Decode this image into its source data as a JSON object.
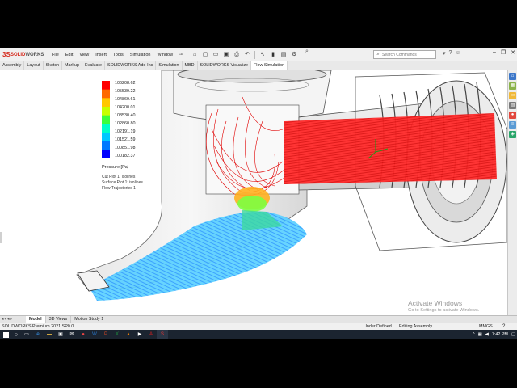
{
  "app": {
    "brand_prefix": "3S",
    "brand_name": "SOLID",
    "brand_suffix": "WORKS"
  },
  "menu": [
    "File",
    "Edit",
    "View",
    "Insert",
    "Tools",
    "Simulation",
    "Window"
  ],
  "quick_access_icons": [
    "home-icon",
    "new-icon",
    "open-icon",
    "save-icon",
    "print-icon",
    "undo-icon",
    "select-icon",
    "rebuild-icon",
    "file-properties-icon",
    "options-icon"
  ],
  "search": {
    "placeholder": "Search Commands"
  },
  "command_tabs": [
    "Assembly",
    "Layout",
    "Sketch",
    "Markup",
    "Evaluate",
    "SOLIDWORKS Add-Ins",
    "Simulation",
    "MBD",
    "SOLIDWORKS Visualize",
    "Flow Simulation"
  ],
  "active_command_tab": "Flow Simulation",
  "legend": {
    "values": [
      "106208.62",
      "105539.22",
      "104869.61",
      "104200.01",
      "103530.40",
      "102860.80",
      "102191.19",
      "101521.59",
      "100851.98",
      "100182.37"
    ],
    "title": "Pressure [Pa]",
    "notes": [
      "Cut Plot 1: isolines",
      "Surface Plot 1: isolines",
      "Flow Trajectories 1"
    ],
    "colors": [
      "#ff0000",
      "#ff6a00",
      "#ffc800",
      "#c8ff00",
      "#3cff3c",
      "#00ffc8",
      "#00c8ff",
      "#0078ff",
      "#0000ff"
    ]
  },
  "watermark": {
    "title": "Activate Windows",
    "subtitle": "Go to Settings to activate Windows."
  },
  "bottom_tabs": [
    "Model",
    "3D Views",
    "Motion Study 1"
  ],
  "active_bottom_tab": "Model",
  "status": {
    "product": "SOLIDWORKS Premium 2021 SP0.0",
    "defined": "Under Defined",
    "editing": "Editing Assembly",
    "units": "MMGS",
    "help": "?"
  },
  "taskbar": {
    "time": "7:42 PM",
    "apps": [
      "task-view-icon",
      "edge-icon",
      "file-explorer-icon",
      "store-icon",
      "mail-icon",
      "chrome-icon",
      "word-icon",
      "powerpoint-icon",
      "excel-icon",
      "vlc-icon",
      "media-icon",
      "acrobat-icon",
      "solidworks-icon"
    ]
  },
  "taskpane_icons": [
    "resources-icon",
    "design-library-icon",
    "file-explorer-icon",
    "view-palette-icon",
    "appearances-icon",
    "custom-properties-icon",
    "flow-results-icon"
  ]
}
